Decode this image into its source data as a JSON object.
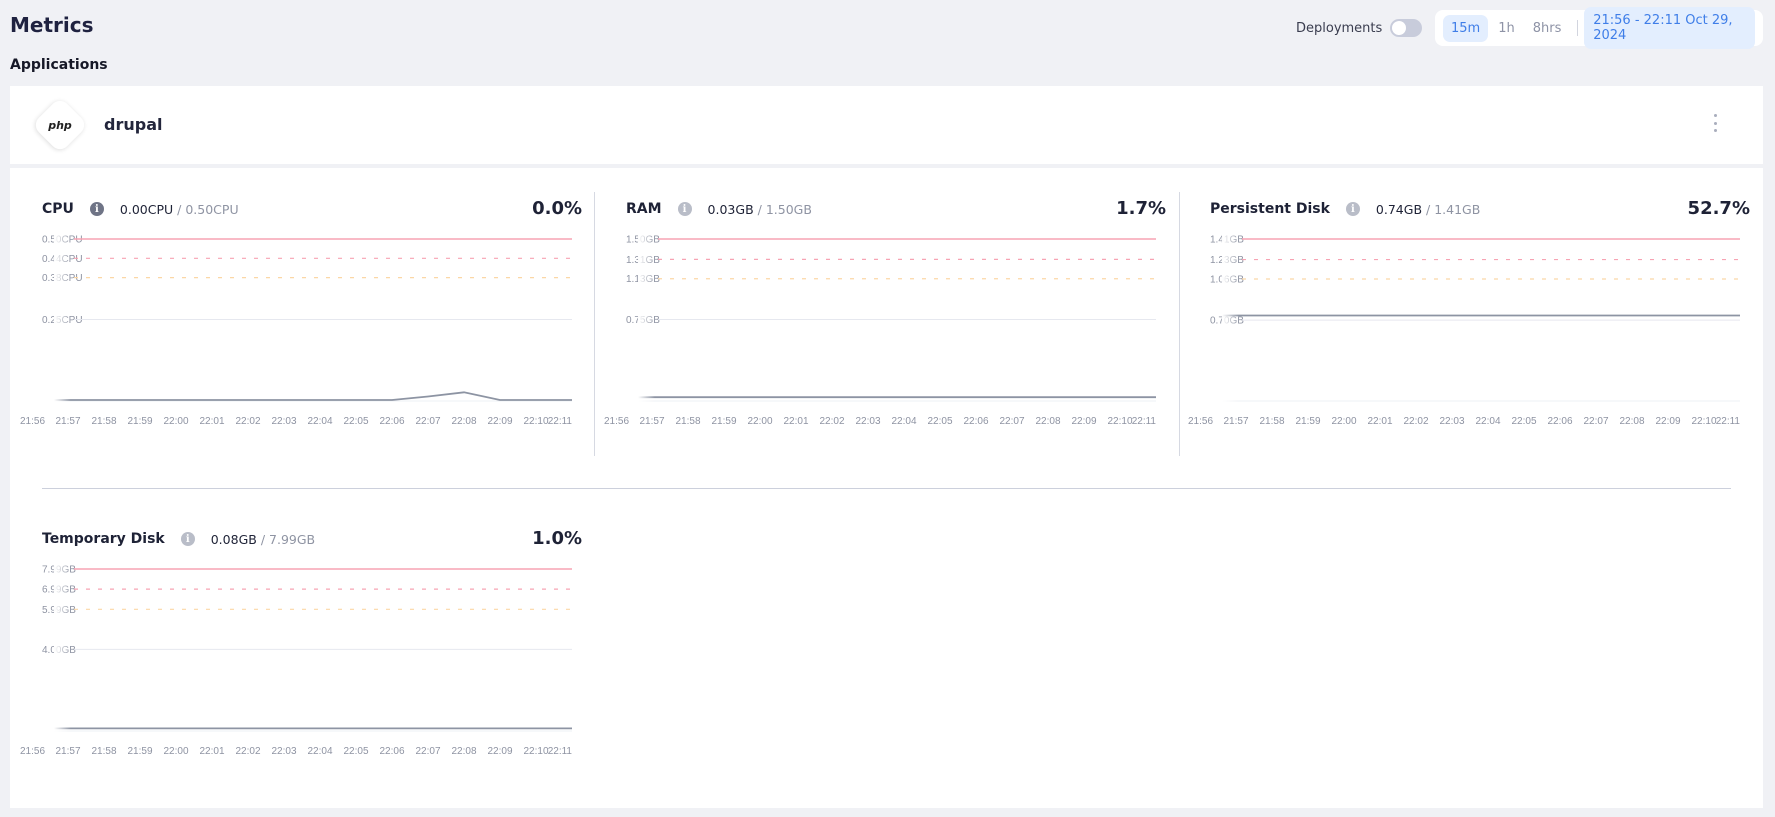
{
  "page": {
    "title": "Metrics",
    "section_title": "Applications"
  },
  "header": {
    "deployments_label": "Deployments",
    "deployments_toggle_on": false,
    "range_options": [
      {
        "label": "15m",
        "active": true
      },
      {
        "label": "1h",
        "active": false
      },
      {
        "label": "8hrs",
        "active": false
      }
    ],
    "date_range": "21:56 - 22:11 Oct 29, 2024"
  },
  "app": {
    "logo_text": "php",
    "name": "drupal",
    "menu_icon": "kebab-vertical-icon"
  },
  "colors": {
    "limit_line": "#f7a3b3",
    "critical_line": "#f7a3b3",
    "warning_line": "#fbd7a6",
    "grid_line": "#e6e8ef",
    "series_line": "#8d94a3",
    "accent": "#3f7ee8"
  },
  "chart_data": [
    {
      "type": "line",
      "title": "CPU",
      "current": "0.00CPU",
      "limit": "/ 0.50CPU",
      "percent": "0.0%",
      "info_icon_dark": true,
      "ylim": [
        0,
        0.5
      ],
      "thresholds": [
        {
          "label": "0.50CPU",
          "value": 0.5,
          "style": "limit"
        },
        {
          "label": "0.44CPU",
          "value": 0.44,
          "style": "critical"
        },
        {
          "label": "0.38CPU",
          "value": 0.38,
          "style": "warning"
        },
        {
          "label": "0.25CPU",
          "value": 0.25,
          "style": "grid"
        }
      ],
      "x": [
        "21:56",
        "21:57",
        "21:58",
        "21:59",
        "22:00",
        "22:01",
        "22:02",
        "22:03",
        "22:04",
        "22:05",
        "22:06",
        "22:07",
        "22:08",
        "22:09",
        "22:10",
        "22:11"
      ],
      "values": [
        0,
        0,
        0,
        0,
        0,
        0,
        0,
        0,
        0,
        0,
        0,
        0.011,
        0.024,
        0,
        0,
        0
      ]
    },
    {
      "type": "line",
      "title": "RAM",
      "current": "0.03GB",
      "limit": "/ 1.50GB",
      "percent": "1.7%",
      "info_icon_dark": false,
      "ylim": [
        0,
        1.5
      ],
      "thresholds": [
        {
          "label": "1.50GB",
          "value": 1.5,
          "style": "limit"
        },
        {
          "label": "1.31GB",
          "value": 1.31,
          "style": "critical"
        },
        {
          "label": "1.13GB",
          "value": 1.13,
          "style": "warning"
        },
        {
          "label": "0.75GB",
          "value": 0.75,
          "style": "grid"
        }
      ],
      "x": [
        "21:56",
        "21:57",
        "21:58",
        "21:59",
        "22:00",
        "22:01",
        "22:02",
        "22:03",
        "22:04",
        "22:05",
        "22:06",
        "22:07",
        "22:08",
        "22:09",
        "22:10",
        "22:11"
      ],
      "values": [
        0.025,
        0.026,
        0.026,
        0.026,
        0.026,
        0.026,
        0.026,
        0.026,
        0.026,
        0.026,
        0.026,
        0.026,
        0.026,
        0.026,
        0.026,
        0.026
      ]
    },
    {
      "type": "line",
      "title": "Persistent Disk",
      "current": "0.74GB",
      "limit": "/ 1.41GB",
      "percent": "52.7%",
      "info_icon_dark": false,
      "ylim": [
        0,
        1.41
      ],
      "thresholds": [
        {
          "label": "1.41GB",
          "value": 1.41,
          "style": "limit"
        },
        {
          "label": "1.23GB",
          "value": 1.23,
          "style": "critical"
        },
        {
          "label": "1.06GB",
          "value": 1.06,
          "style": "warning"
        },
        {
          "label": "0.70GB",
          "value": 0.7,
          "style": "grid"
        }
      ],
      "x": [
        "21:56",
        "21:57",
        "21:58",
        "21:59",
        "22:00",
        "22:01",
        "22:02",
        "22:03",
        "22:04",
        "22:05",
        "22:06",
        "22:07",
        "22:08",
        "22:09",
        "22:10",
        "22:11"
      ],
      "values": [
        0.74,
        0.74,
        0.74,
        0.74,
        0.74,
        0.74,
        0.74,
        0.74,
        0.74,
        0.74,
        0.74,
        0.74,
        0.74,
        0.74,
        0.74,
        0.74
      ]
    },
    {
      "type": "line",
      "title": "Temporary Disk",
      "current": "0.08GB",
      "limit": "/ 7.99GB",
      "percent": "1.0%",
      "info_icon_dark": false,
      "ylim": [
        0,
        7.99
      ],
      "thresholds": [
        {
          "label": "7.99GB",
          "value": 7.99,
          "style": "limit"
        },
        {
          "label": "6.99GB",
          "value": 6.99,
          "style": "critical"
        },
        {
          "label": "5.99GB",
          "value": 5.99,
          "style": "warning"
        },
        {
          "label": "4.00GB",
          "value": 4.0,
          "style": "grid"
        }
      ],
      "x": [
        "21:56",
        "21:57",
        "21:58",
        "21:59",
        "22:00",
        "22:01",
        "22:02",
        "22:03",
        "22:04",
        "22:05",
        "22:06",
        "22:07",
        "22:08",
        "22:09",
        "22:10",
        "22:11"
      ],
      "values": [
        0.08,
        0.08,
        0.08,
        0.08,
        0.08,
        0.08,
        0.08,
        0.08,
        0.08,
        0.08,
        0.08,
        0.08,
        0.08,
        0.08,
        0.08,
        0.08
      ]
    }
  ]
}
